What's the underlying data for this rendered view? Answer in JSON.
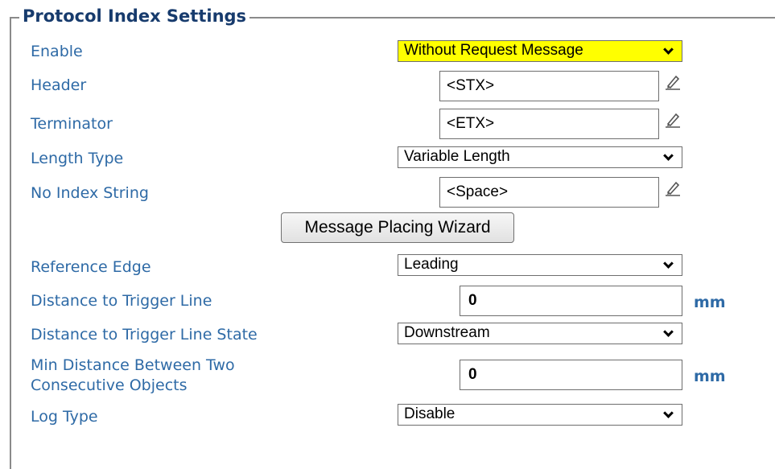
{
  "section": {
    "title": "Protocol Index Settings"
  },
  "rows": {
    "enable": {
      "label": "Enable",
      "value": "Without Request Message"
    },
    "header": {
      "label": "Header",
      "value": "<STX>"
    },
    "terminator": {
      "label": "Terminator",
      "value": "<ETX>"
    },
    "length_type": {
      "label": "Length Type",
      "value": "Variable Length"
    },
    "no_index_string": {
      "label": "No Index String",
      "value": "<Space>"
    },
    "reference_edge": {
      "label": "Reference Edge",
      "value": "Leading"
    },
    "distance_trigger": {
      "label": "Distance to Trigger Line",
      "value": "0",
      "unit": "mm"
    },
    "distance_trigger_state": {
      "label": "Distance to Trigger Line State",
      "value": "Downstream"
    },
    "min_distance": {
      "label_line1": "Min Distance Between Two",
      "label_line2": "Consecutive Objects",
      "value": "0",
      "unit": "mm"
    },
    "log_type": {
      "label": "Log Type",
      "value": "Disable"
    }
  },
  "wizard_button": {
    "label": "Message Placing Wizard"
  },
  "colors": {
    "highlight": "#ffff00",
    "label": "#2e6aa6",
    "title": "#173b6d"
  },
  "icons": {
    "edit": "pencil-icon",
    "dropdown": "chevron-down-icon"
  }
}
